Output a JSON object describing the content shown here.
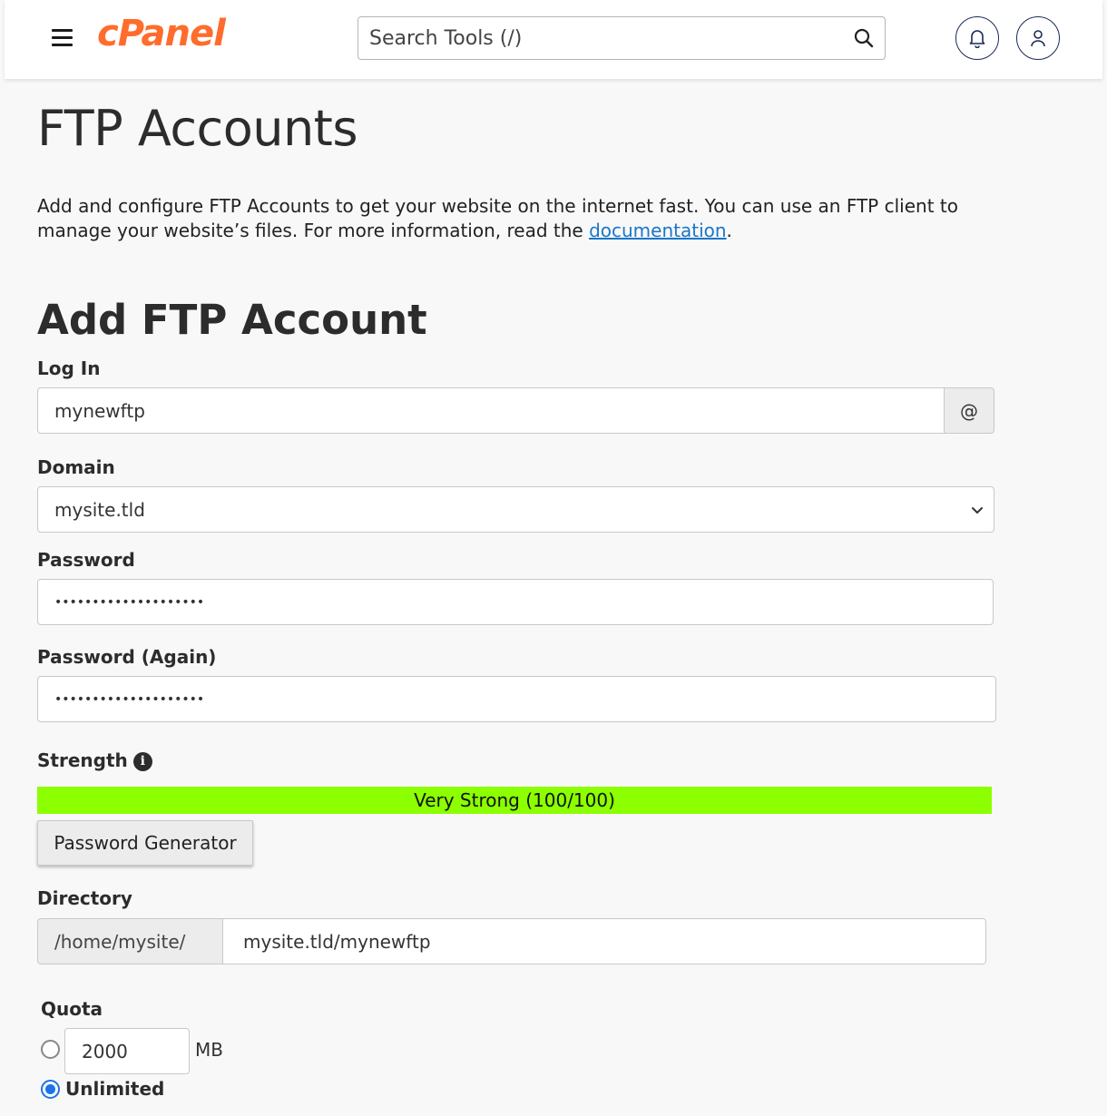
{
  "header": {
    "logo": "cPanel",
    "search_placeholder": "Search Tools (/)"
  },
  "page": {
    "title": "FTP Accounts",
    "intro_text": "Add and configure FTP Accounts to get your website on the internet fast. You can use an FTP client to manage your website’s files. For more information, read the ",
    "intro_link": "documentation",
    "intro_end": "."
  },
  "form": {
    "section_title": "Add FTP Account",
    "login": {
      "label": "Log In",
      "value": "mynewftp",
      "addon": "@"
    },
    "domain": {
      "label": "Domain",
      "value": "mysite.tld",
      "options": [
        "mysite.tld"
      ]
    },
    "password": {
      "label": "Password",
      "value": "••••••••••••••••••••"
    },
    "password_again": {
      "label": "Password (Again)",
      "value": "••••••••••••••••••••"
    },
    "strength": {
      "label": "Strength",
      "text": "Very Strong (100/100)",
      "score": 100,
      "bar_color": "#8cff00"
    },
    "generator_button": "Password Generator",
    "directory": {
      "label": "Directory",
      "prefix": "/home/mysite/",
      "value": "mysite.tld/mynewftp"
    },
    "quota": {
      "label": "Quota",
      "value": "2000",
      "unit": "MB",
      "unlimited_label": "Unlimited",
      "selected": "unlimited"
    }
  },
  "colors": {
    "brand": "#ff6c2c",
    "link": "#1b76c8",
    "radio_selected": "#1a73e8"
  }
}
